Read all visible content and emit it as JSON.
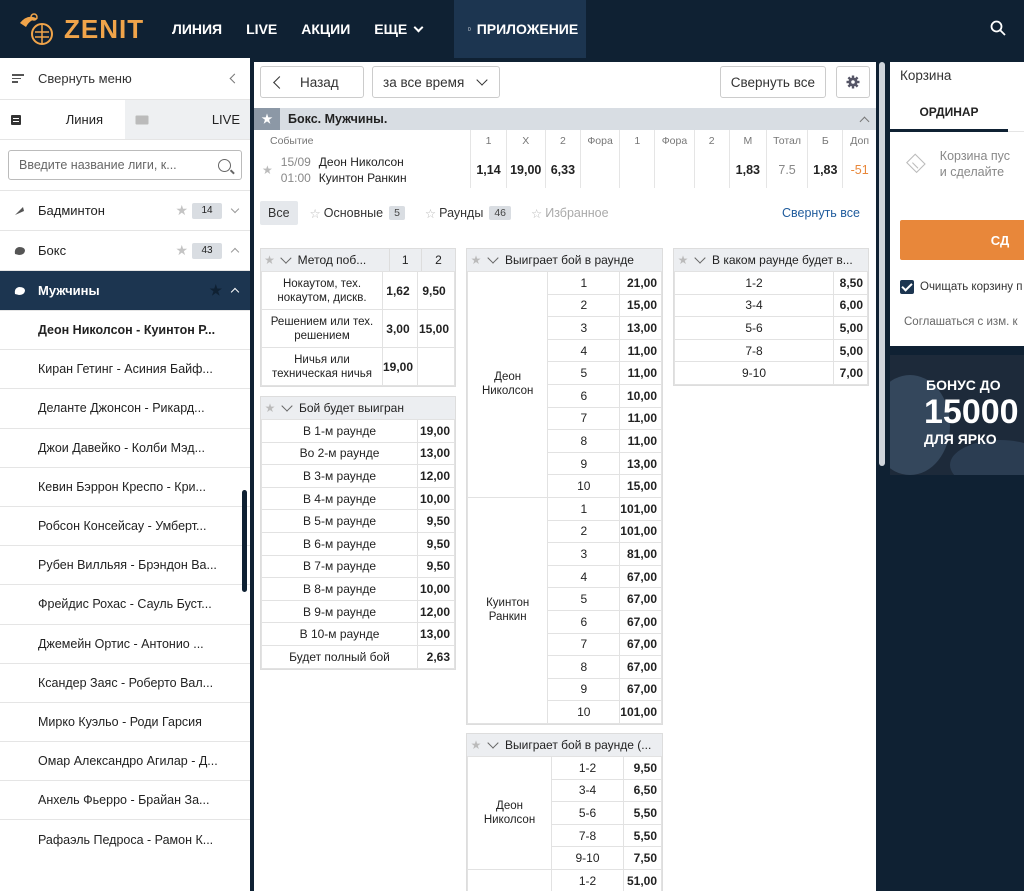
{
  "header": {
    "logo": "ZENIT",
    "nav": [
      "ЛИНИЯ",
      "LIVE",
      "АКЦИИ",
      "ЕЩЕ"
    ],
    "app": "ПРИЛОЖЕНИЕ"
  },
  "sidebar": {
    "collapse": "Свернуть меню",
    "tab_line": "Линия",
    "tab_live": "LIVE",
    "search_placeholder": "Введите название лиги, к...",
    "sports": [
      {
        "name": "Бадминтон",
        "count": "14"
      },
      {
        "name": "Бокс",
        "count": "43"
      }
    ],
    "league": "Мужчины",
    "events": [
      "Деон Николсон - Куинтон Р...",
      "Киран Гетинг - Асиния Байф...",
      "Деланте Джонсон - Рикард...",
      "Джои Давейко - Колби Мэд...",
      "Кевин Бэррон Креспо - Кри...",
      "Робсон Консейсау - Умберт...",
      "Рубен Вилльяя - Брэндон Ва...",
      "Фрейдис Рохас - Сауль Буст...",
      "Джемейн Ортис - Антонио ...",
      "Ксандер Заяс - Роберто Вал...",
      "Мирко Куэльо - Роди Гарсия",
      "Омар Александро Агилар - Д...",
      "Анхель Фьерро - Брайан За...",
      "Рафаэль Педроса - Рамон К..."
    ]
  },
  "toolbar": {
    "back": "Назад",
    "period": "за все время",
    "collapse_all": "Свернуть все"
  },
  "event": {
    "title": "Бокс. Мужчины.",
    "columns": [
      "Событие",
      "1",
      "X",
      "2",
      "Фора",
      "1",
      "Фора",
      "2",
      "М",
      "Тотал",
      "Б",
      "Доп"
    ],
    "date": "15/09",
    "time": "01:00",
    "team1": "Деон Николсон",
    "team2": "Куинтон Ранкин",
    "odds": [
      "1,14",
      "19,00",
      "6,33",
      "",
      "",
      "",
      "",
      "1,83",
      "7.5",
      "1,83",
      "-51"
    ]
  },
  "filters": {
    "all": "Все",
    "main": "Основные",
    "main_count": "5",
    "rounds": "Раунды",
    "rounds_count": "46",
    "fav": "Избранное",
    "collapse": "Свернуть все"
  },
  "market_method": {
    "title": "Метод поб...",
    "col1": "1",
    "col2": "2",
    "rows": [
      {
        "name": "Нокаутом, тех. нокаутом, дискв.",
        "v1": "1,62",
        "v2": "9,50"
      },
      {
        "name": "Решением или тех. решением",
        "v1": "3,00",
        "v2": "15,00"
      },
      {
        "name": "Ничья или техническая ничья",
        "v1": "19,00",
        "v2": ""
      }
    ]
  },
  "market_won": {
    "title": "Бой будет выигран",
    "rows": [
      {
        "name": "В 1-м раунде",
        "v": "19,00"
      },
      {
        "name": "Во 2-м раунде",
        "v": "13,00"
      },
      {
        "name": "В 3-м раунде",
        "v": "12,00"
      },
      {
        "name": "В 4-м раунде",
        "v": "10,00"
      },
      {
        "name": "В 5-м раунде",
        "v": "9,50"
      },
      {
        "name": "В 6-м раунде",
        "v": "9,50"
      },
      {
        "name": "В 7-м раунде",
        "v": "9,50"
      },
      {
        "name": "В 8-м раунде",
        "v": "10,00"
      },
      {
        "name": "В 9-м раунде",
        "v": "12,00"
      },
      {
        "name": "В 10-м раунде",
        "v": "13,00"
      },
      {
        "name": "Будет полный бой",
        "v": "2,63"
      }
    ]
  },
  "market_round": {
    "title": "Выиграет бой в раунде",
    "p1": "Деон Николсон",
    "p2": "Куинтон Ранкин",
    "p1_rows": [
      [
        "1",
        "21,00"
      ],
      [
        "2",
        "15,00"
      ],
      [
        "3",
        "13,00"
      ],
      [
        "4",
        "11,00"
      ],
      [
        "5",
        "11,00"
      ],
      [
        "6",
        "10,00"
      ],
      [
        "7",
        "11,00"
      ],
      [
        "8",
        "11,00"
      ],
      [
        "9",
        "13,00"
      ],
      [
        "10",
        "15,00"
      ]
    ],
    "p2_rows": [
      [
        "1",
        "101,00"
      ],
      [
        "2",
        "101,00"
      ],
      [
        "3",
        "81,00"
      ],
      [
        "4",
        "67,00"
      ],
      [
        "5",
        "67,00"
      ],
      [
        "6",
        "67,00"
      ],
      [
        "7",
        "67,00"
      ],
      [
        "8",
        "67,00"
      ],
      [
        "9",
        "67,00"
      ],
      [
        "10",
        "101,00"
      ]
    ]
  },
  "market_round_group": {
    "title": "Выиграет бой в раунде (...",
    "p1": "Деон Николсон",
    "p1_rows": [
      [
        "1-2",
        "9,50"
      ],
      [
        "3-4",
        "6,50"
      ],
      [
        "5-6",
        "5,50"
      ],
      [
        "7-8",
        "5,50"
      ],
      [
        "9-10",
        "7,50"
      ]
    ],
    "p2_rows": [
      [
        "1-2",
        "51,00"
      ]
    ]
  },
  "market_which": {
    "title": "В каком раунде будет в...",
    "rows": [
      [
        "1-2",
        "8,50"
      ],
      [
        "3-4",
        "6,00"
      ],
      [
        "5-6",
        "5,00"
      ],
      [
        "7-8",
        "5,00"
      ],
      [
        "9-10",
        "7,00"
      ]
    ]
  },
  "cart": {
    "title": "Корзина",
    "tab": "ОРДИНАР",
    "empty1": "Корзина пус",
    "empty2": "и сделайте",
    "button": "СД",
    "clear": "Очищать корзину п",
    "agree": "Соглашаться с изм. к"
  },
  "banner": {
    "l1": "БОНУС ДО",
    "l2": "15000",
    "l3": "ДЛЯ ЯРКО"
  }
}
